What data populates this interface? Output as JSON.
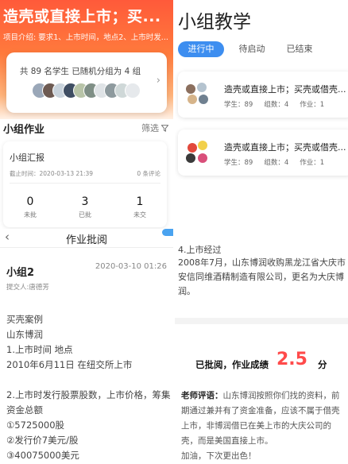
{
  "left": {
    "hero_title": "造壳或直接上市；买...",
    "hero_sub": "项目介绍: 要求1、上市时间，地点2、上市时发...",
    "group_summary": "共 89 名学生  已随机分组为 4 组",
    "hw_title": "小组作业",
    "filter_label": "筛选",
    "report": {
      "title": "小组汇报",
      "deadline": "截止时间：2020-03-13 21:39",
      "comments": "0 条评论",
      "stats": [
        {
          "num": "0",
          "label": "未批"
        },
        {
          "num": "3",
          "label": "已批"
        },
        {
          "num": "1",
          "label": "未交"
        }
      ]
    },
    "review_title": "作业批阅",
    "back_icon": "‹",
    "submission": {
      "name": "小组2",
      "date": "2020-03-10 01:26",
      "submitter": "提交人:唐德芳",
      "lines": [
        "买壳案例",
        "山东博润",
        "1.上市时间 地点",
        "  2010年6月11日  在纽交所上市",
        "",
        "2.上市时发行股票股数，上市价格，筹集",
        "资金总额",
        "  ①5725000股",
        "  ②发行价7美元/股",
        "  ③40075000美元"
      ]
    }
  },
  "right": {
    "title": "小组教学",
    "tabs": [
      "进行中",
      "待启动",
      "已结束"
    ],
    "cards": [
      {
        "title": "造壳或直接上市；买壳或借壳...",
        "students": "学生：89",
        "groups": "组数：4",
        "homework": "作业：1"
      },
      {
        "title": "造壳或直接上市；买壳或借壳...",
        "students": "学生：89",
        "groups": "组数：4",
        "homework": "作业：1"
      }
    ],
    "section_title": "4.上市经过",
    "section_text": "2008年7月，山东博润收购黑龙江省大庆市安信同维酒精制造有限公司，更名为大庆博润。",
    "grade_label": "已批阅，作业成绩",
    "grade_score": "2.5",
    "grade_unit": "分",
    "comment_label": "老师评语：",
    "comment_text": "山东博润按照你们找的资料，前期通过兼并有了资金准备，应该不属于借壳上市，非博润借已在美上市的大庆公司的壳，而是美国直接上市。",
    "comment_end": "加油，下次更出色！"
  },
  "colors": {
    "accent_blue": "#3d8ef0",
    "hero_orange": "#ff5a3a",
    "score_red": "#ff4a4a"
  },
  "icons": [
    "chevron-right-icon",
    "filter-icon",
    "back-icon",
    "avatar"
  ]
}
